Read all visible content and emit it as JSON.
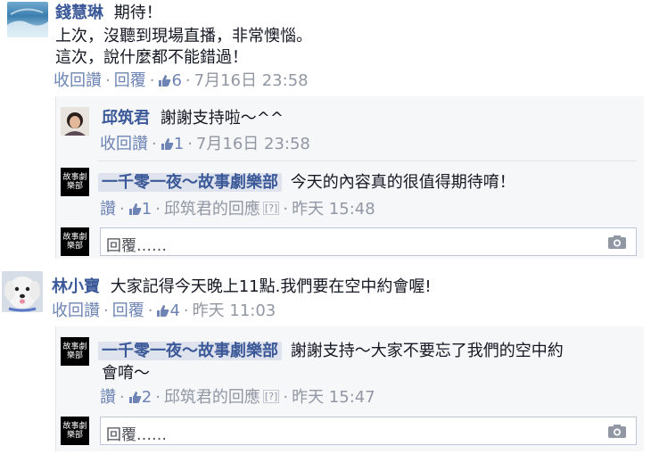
{
  "comments": [
    {
      "author": "錢慧琳",
      "text_lines": [
        "期待！",
        "上次，沒聽到現場直播，非常懊惱。",
        "這次，說什麼都不能錯過！"
      ],
      "unlike": "收回讚",
      "reply": "回覆",
      "likes": "6",
      "time": "7月16日 23:58",
      "avatar_icon": "ocean-photo-avatar",
      "replies": [
        {
          "author": "邱筑君",
          "text": "謝謝支持啦～^^",
          "unlike": "收回讚",
          "likes": "1",
          "time": "7月16日 23:58",
          "avatar_icon": "person-photo-avatar"
        },
        {
          "author": "一千零一夜～故事劇樂部",
          "text": "今天的內容真的很值得期待唷！",
          "like": "讚",
          "likes": "1",
          "page_reply_by": "邱筑君的回應",
          "info_mark": "[?]",
          "time": "昨天 15:48",
          "avatar_icon": "page-logo-avatar"
        }
      ],
      "reply_placeholder": "回覆……"
    },
    {
      "author": "林小寶",
      "text": "大家記得今天晚上11點.我們要在空中約會喔!",
      "unlike": "收回讚",
      "reply": "回覆",
      "likes": "4",
      "time": "昨天 11:03",
      "avatar_icon": "white-dog-avatar",
      "replies": [
        {
          "author": "一千零一夜～故事劇樂部",
          "text_lines": [
            "謝謝支持～大家不要忘了我們的空中約",
            "會唷～"
          ],
          "like": "讚",
          "likes": "2",
          "page_reply_by": "邱筑君的回應",
          "info_mark": "[?]",
          "time": "昨天 15:47",
          "avatar_icon": "page-logo-avatar"
        }
      ],
      "reply_placeholder": "回覆……"
    }
  ],
  "logo_text": "故事劇樂部",
  "colors": {
    "link": "#3b5998",
    "meta": "#9197a3",
    "reply_bg": "#f6f7f9",
    "tag_bg": "#dfe3ee"
  }
}
